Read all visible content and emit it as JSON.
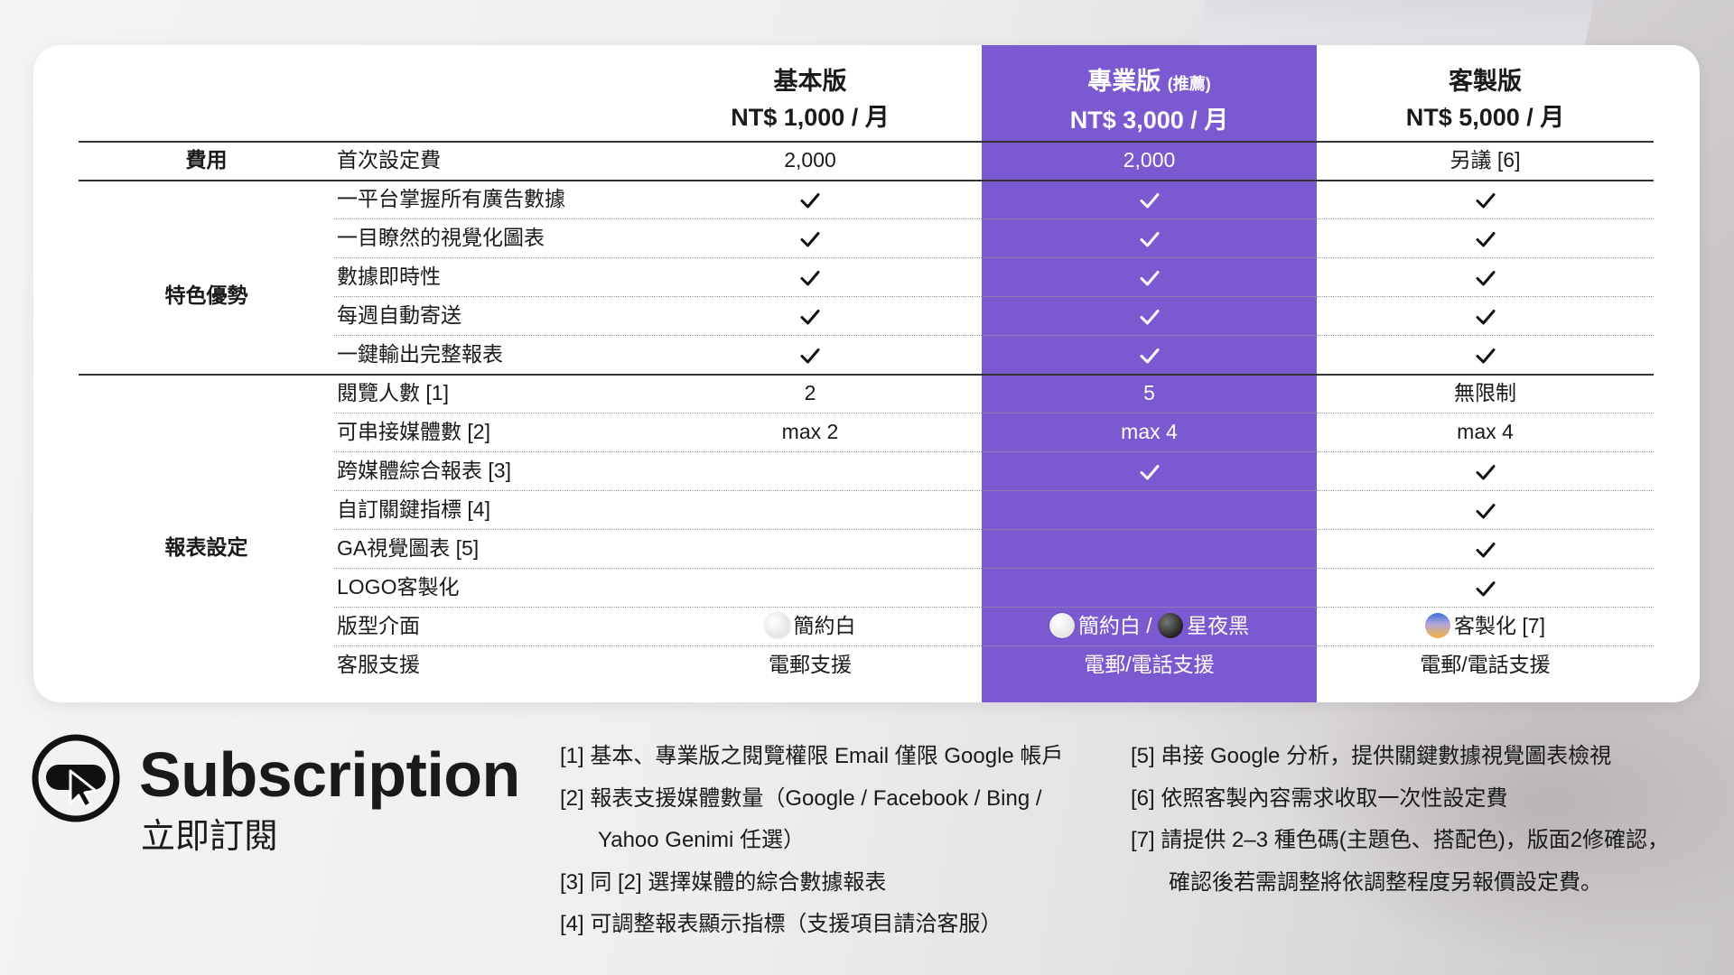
{
  "plans": [
    {
      "name": "基本版",
      "tag": "",
      "price": "NT$ 1,000 / 月"
    },
    {
      "name": "專業版",
      "tag": "(推薦)",
      "price": "NT$ 3,000 / 月"
    },
    {
      "name": "客製版",
      "tag": "",
      "price": "NT$ 5,000 / 月"
    }
  ],
  "categories": {
    "fee": "費用",
    "features": "特色優勢",
    "report": "報表設定"
  },
  "rows": [
    {
      "label": "首次設定費",
      "values": [
        "2,000",
        "2,000",
        "另議 [6]"
      ]
    },
    {
      "label": "一平台掌握所有廣告數據",
      "values": [
        "check",
        "check",
        "check"
      ]
    },
    {
      "label": "一目瞭然的視覺化圖表",
      "values": [
        "check",
        "check",
        "check"
      ]
    },
    {
      "label": "數據即時性",
      "values": [
        "check",
        "check",
        "check"
      ]
    },
    {
      "label": "每週自動寄送",
      "values": [
        "check",
        "check",
        "check"
      ]
    },
    {
      "label": "一鍵輸出完整報表",
      "values": [
        "check",
        "check",
        "check"
      ]
    },
    {
      "label": "閱覽人數 [1]",
      "values": [
        "2",
        "5",
        "無限制"
      ]
    },
    {
      "label": "可串接媒體數 [2]",
      "values": [
        "max 2",
        "max 4",
        "max 4"
      ]
    },
    {
      "label": "跨媒體綜合報表 [3]",
      "values": [
        "",
        "check",
        "check"
      ]
    },
    {
      "label": "自訂關鍵指標 [4]",
      "values": [
        "",
        "",
        "check"
      ]
    },
    {
      "label": "GA視覺圖表 [5]",
      "values": [
        "",
        "",
        "check"
      ]
    },
    {
      "label": "LOGO客製化",
      "values": [
        "",
        "",
        "check"
      ]
    },
    {
      "label": "版型介面",
      "values": [
        "",
        "",
        ""
      ]
    },
    {
      "label": "客服支援",
      "values": [
        "電郵支援",
        "電郵/電話支援",
        "電郵/電話支援"
      ]
    }
  ],
  "themes": {
    "basic": "簡約白",
    "pro_a": "簡約白",
    "pro_sep": " / ",
    "pro_b": "星夜黑",
    "custom": "客製化 [7]"
  },
  "brand": {
    "title": "Subscription",
    "subtitle": "立即訂閱",
    "icon": "cursor-click-icon"
  },
  "notes_left": [
    "[1] 基本、專業版之閱覽權限 Email 僅限 Google 帳戶",
    "[2] 報表支援媒體數量（Google / Facebook / Bing /",
    "Yahoo Genimi 任選）",
    "[3] 同 [2] 選擇媒體的綜合數據報表",
    "[4] 可調整報表顯示指標（支援項目請洽客服）"
  ],
  "notes_right": [
    "[5] 串接 Google 分析，提供關鍵數據視覺圖表檢視",
    "[6] 依照客製內容需求收取一次性設定費",
    "[7] 請提供 2–3 種色碼(主題色、搭配色)，版面2修確認，",
    "確認後若需調整將依調整程度另報價設定費。"
  ],
  "colors": {
    "highlight": "#7b59d0",
    "card": "#ffffff",
    "text": "#1a1a1a"
  }
}
